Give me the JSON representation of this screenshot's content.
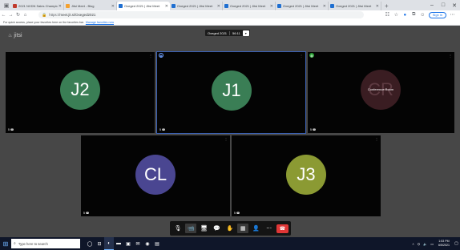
{
  "browser": {
    "tabs": [
      {
        "title": "2021 NXDN Sales Championship",
        "favicon": "default-favicon"
      },
      {
        "title": "Jitsi Meet - Blog",
        "favicon": "blog-favicon"
      },
      {
        "title": "Oxeged 2021 | Jitsi Meet",
        "favicon": "jitsi-favicon",
        "active": true
      },
      {
        "title": "Oxeged 2021 | Jitsi Meet",
        "favicon": "jitsi-favicon"
      },
      {
        "title": "Oxeged 2021 | Jitsi Meet",
        "favicon": "jitsi-favicon"
      },
      {
        "title": "Oxeged 2021 | Jitsi Meet",
        "favicon": "jitsi-favicon"
      },
      {
        "title": "Oxeged 2021 | Jitsi Meet",
        "favicon": "jitsi-favicon"
      }
    ],
    "url_scheme": "https://",
    "url": "meet.jit.si/Oxeged2021",
    "signin_label": "Sign in",
    "bookmark_message": "For quick access, place your favorites here on the favorites bar.",
    "bookmark_link": "Manage favorites now"
  },
  "meeting": {
    "brand": "jitsi",
    "room_name": "Oxeged 2021",
    "timer": "56:11",
    "participants": [
      {
        "initials": "J2",
        "color": "#3a7e55",
        "label": "5 ☎"
      },
      {
        "initials": "J1",
        "color": "#3a7e55",
        "label": "5 ☎",
        "dominant": true
      },
      {
        "initials": "CR",
        "color": "#3a1d22",
        "label": "5 ☎",
        "overlay": "Conference Room"
      },
      {
        "initials": "CL",
        "color": "#4a4691",
        "label": "5 ☎"
      },
      {
        "initials": "J3",
        "color": "#8b9a33",
        "label": "5 ☎"
      }
    ],
    "toolbar": [
      {
        "name": "mic-button",
        "icon": "microphone-icon",
        "glyph": "🎙"
      },
      {
        "name": "camera-button",
        "icon": "camera-icon",
        "glyph": "📹",
        "on": true
      },
      {
        "name": "share-screen-button",
        "icon": "desktop-share-icon",
        "glyph": "🖥"
      },
      {
        "name": "chat-button",
        "icon": "chat-icon",
        "glyph": "💬"
      },
      {
        "name": "raise-hand-button",
        "icon": "hand-icon",
        "glyph": "✋"
      },
      {
        "name": "tile-view-button",
        "icon": "tile-view-icon",
        "glyph": "▦",
        "on": true
      },
      {
        "name": "participants-button",
        "icon": "participants-icon",
        "glyph": "👤"
      },
      {
        "name": "more-button",
        "icon": "more-icon",
        "glyph": "⋯"
      },
      {
        "name": "leave-button",
        "icon": "hangup-icon",
        "glyph": "☎",
        "leave": true
      }
    ]
  },
  "taskbar": {
    "search_placeholder": "Type here to search",
    "time": "1:53 PM",
    "date": "6/5/2021"
  },
  "colors": {
    "meeting_bg": "#474747",
    "dominant_border": "#3b62b8",
    "leave_red": "#e03636",
    "taskbar": "#0f1629"
  }
}
